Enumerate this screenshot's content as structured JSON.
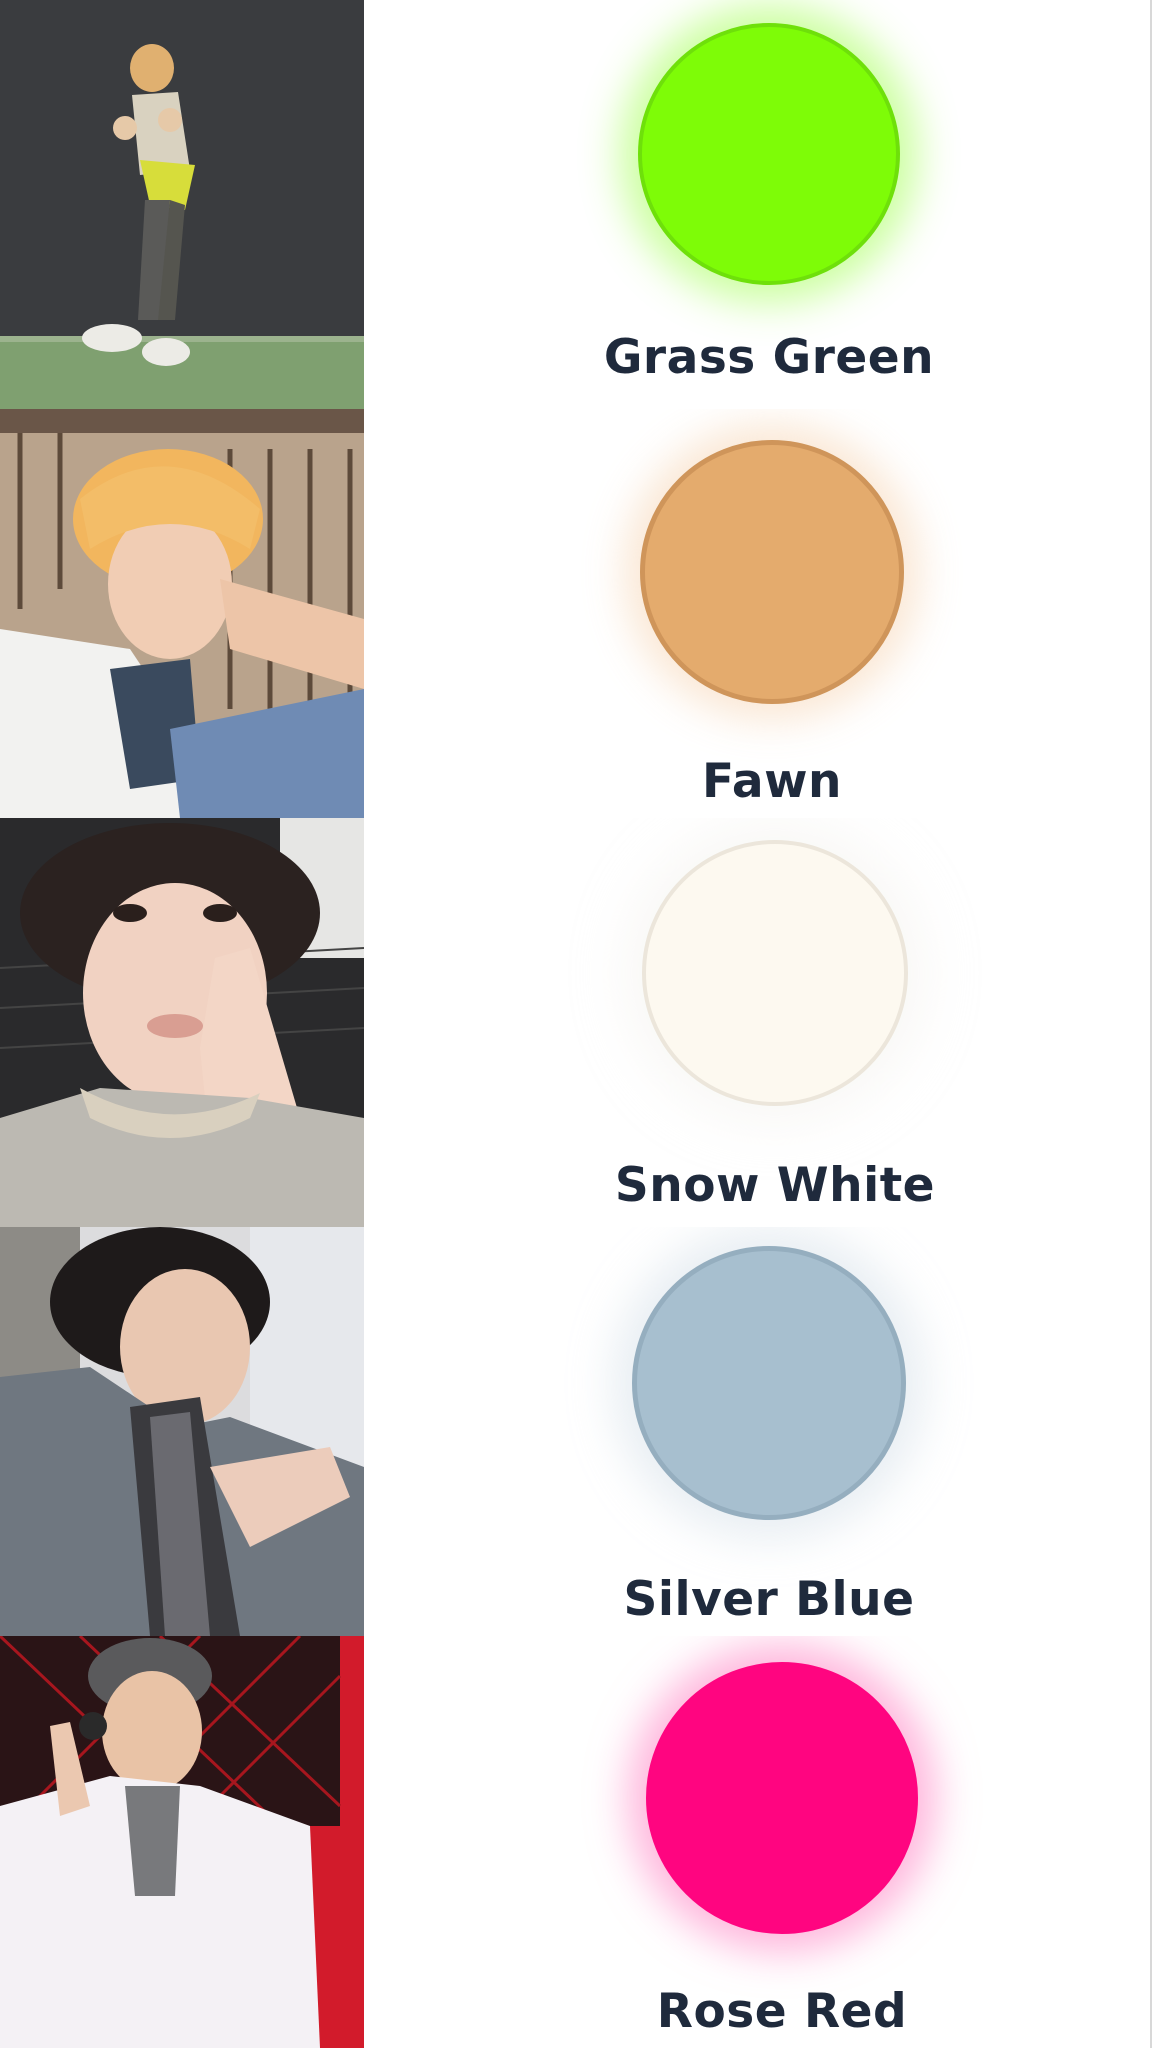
{
  "rows": [
    {
      "label": "Grass Green",
      "color": "#7efc07",
      "border": "#6ee00a",
      "glow": "#8cff2a",
      "photo_icon": "person-photo"
    },
    {
      "label": "Fawn",
      "color": "#e4ab6d",
      "border": "#cf955a",
      "glow": "#f3c9a0",
      "photo_icon": "person-photo"
    },
    {
      "label": "Snow White",
      "color": "#fdf9f0",
      "border": "#ece6db",
      "glow": "#eeeae6",
      "photo_icon": "person-photo"
    },
    {
      "label": "Silver Blue",
      "color": "#a7bfcf",
      "border": "#95aebf",
      "glow": "#c4d3de",
      "photo_icon": "person-photo"
    },
    {
      "label": "Rose Red",
      "color": "#ff0580",
      "border": "#ff0580",
      "glow": "#ff7ac0",
      "photo_icon": "person-photo"
    }
  ]
}
